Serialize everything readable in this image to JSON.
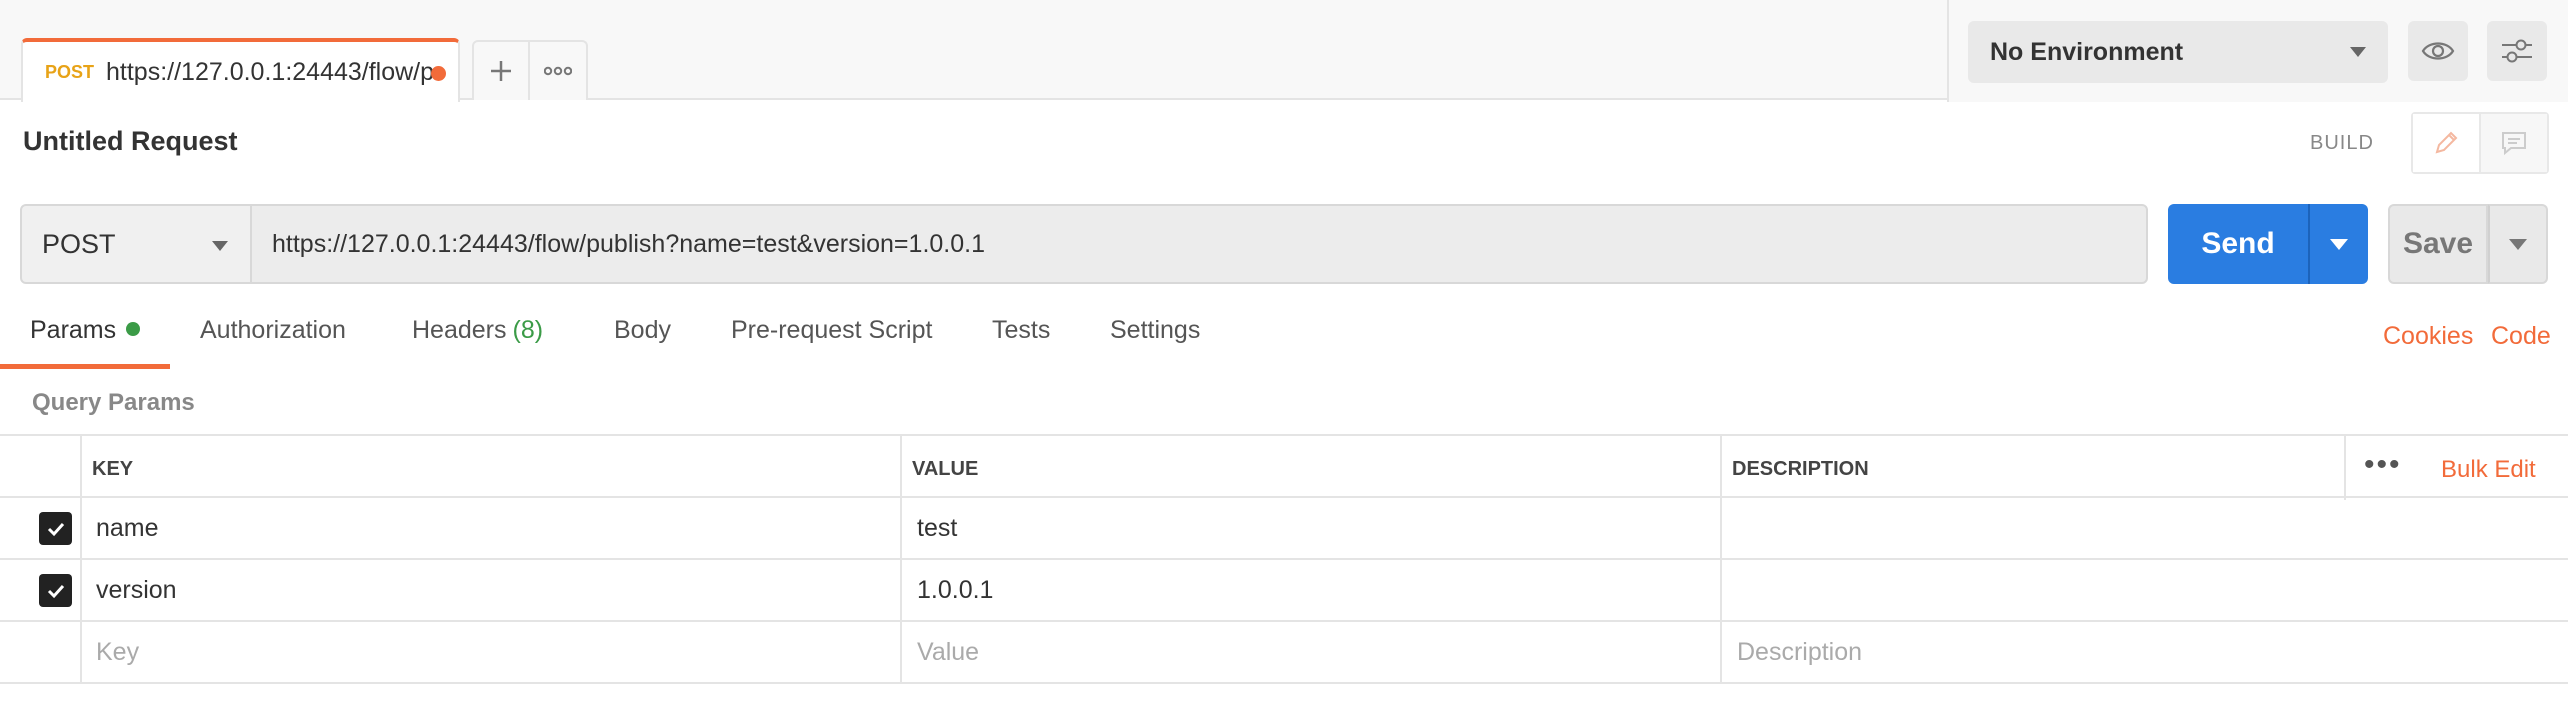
{
  "tab": {
    "method": "POST",
    "url": "https://127.0.0.1:24443/flow/p..."
  },
  "environment": {
    "selected": "No Environment"
  },
  "request": {
    "title": "Untitled Request",
    "mode_label": "BUILD",
    "method": "POST",
    "url": "https://127.0.0.1:24443/flow/publish?name=test&version=1.0.0.1",
    "send_label": "Send",
    "save_label": "Save"
  },
  "request_tabs": [
    {
      "label": "Params",
      "active": true
    },
    {
      "label": "Authorization"
    },
    {
      "label": "Headers",
      "count": "(8)"
    },
    {
      "label": "Body"
    },
    {
      "label": "Pre-request Script"
    },
    {
      "label": "Tests"
    },
    {
      "label": "Settings"
    }
  ],
  "links": {
    "cookies": "Cookies",
    "code": "Code"
  },
  "query_params": {
    "section_label": "Query Params",
    "columns": [
      "KEY",
      "VALUE",
      "DESCRIPTION"
    ],
    "bulk_edit": "Bulk Edit",
    "rows": [
      {
        "key": "name",
        "value": "test",
        "description": "",
        "checked": true
      },
      {
        "key": "version",
        "value": "1.0.0.1",
        "description": "",
        "checked": true
      }
    ],
    "placeholders": {
      "key": "Key",
      "value": "Value",
      "description": "Description"
    }
  },
  "colors": {
    "accent": "#f26b3a",
    "send": "#2a7de1",
    "status_green": "#3b9b47",
    "method_orange": "#e8a317"
  }
}
